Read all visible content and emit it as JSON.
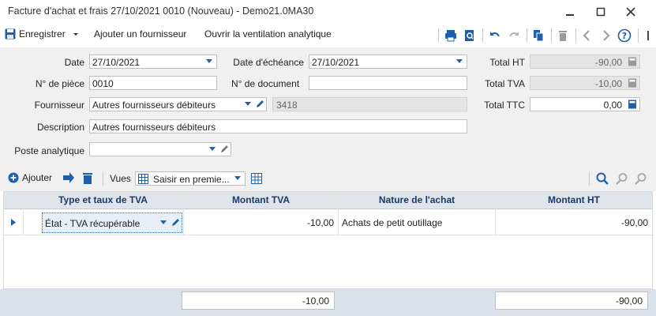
{
  "window": {
    "title": "Facture d'achat et frais 27/10/2021 0010 (Nouveau) - Demo21.0MA30"
  },
  "toolbar": {
    "save_label": "Enregistrer",
    "add_supplier_label": "Ajouter un fournisseur",
    "analytic_label": "Ouvrir la ventilation analytique"
  },
  "form": {
    "date_label": "Date",
    "date_value": "27/10/2021",
    "due_date_label": "Date d'échéance",
    "due_date_value": "27/10/2021",
    "piece_label": "N° de pièce",
    "piece_value": "0010",
    "document_label": "N° de document",
    "document_value": "",
    "supplier_label": "Fournisseur",
    "supplier_value": "Autres fournisseurs débiteurs",
    "supplier_code": "3418",
    "description_label": "Description",
    "description_value": "Autres fournisseurs débiteurs",
    "analytic_post_label": "Poste analytique",
    "analytic_post_value": ""
  },
  "totals": {
    "ht_label": "Total HT",
    "ht_value": "-90,00",
    "tva_label": "Total TVA",
    "tva_value": "-10,00",
    "ttc_label": "Total TTC",
    "ttc_value": "0,00"
  },
  "gridbar": {
    "add_label": "Ajouter",
    "views_label": "Vues",
    "views_value": "Saisir en premie..."
  },
  "grid": {
    "columns": [
      "Type et taux de TVA",
      "Montant TVA",
      "Nature de l'achat",
      "Montant HT"
    ],
    "rows": [
      {
        "type": "État - TVA récupérable",
        "montant_tva": "-10,00",
        "nature": "Achats de petit outillage",
        "montant_ht": "-90,00"
      }
    ],
    "footer_tva": "-10,00",
    "footer_ht": "-90,00"
  },
  "colors": {
    "accent": "#1f5fa8",
    "header_bg": "#dfe3ea",
    "footer_bg": "#dbe1ea",
    "form_bg": "#f0f0f0"
  }
}
